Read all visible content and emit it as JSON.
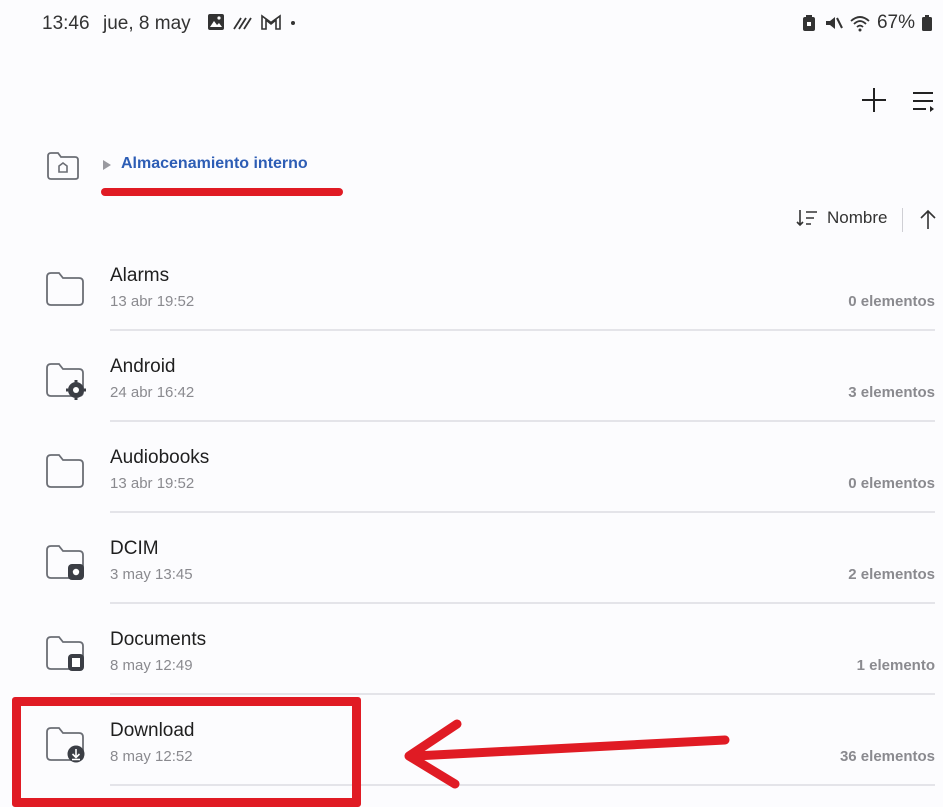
{
  "status_bar": {
    "time": "13:46",
    "date": "jue, 8 may",
    "battery": "67%",
    "notification_icons": [
      "gallery-icon",
      "signal-boost-icon",
      "gmail-icon",
      "dot-icon"
    ],
    "system_icons": [
      "battery-saver-icon",
      "mute-icon",
      "wifi-icon",
      "battery-icon"
    ]
  },
  "toolbar": {
    "actions": [
      "add-icon",
      "sort-menu-icon"
    ]
  },
  "breadcrumb": {
    "current": "Almacenamiento interno"
  },
  "sort": {
    "label": "Nombre",
    "direction": "ascending"
  },
  "files": [
    {
      "name": "Alarms",
      "date": "13 abr 19:52",
      "count": "0 elementos",
      "badge": ""
    },
    {
      "name": "Android",
      "date": "24 abr 16:42",
      "count": "3 elementos",
      "badge": "gear"
    },
    {
      "name": "Audiobooks",
      "date": "13 abr 19:52",
      "count": "0 elementos",
      "badge": ""
    },
    {
      "name": "DCIM",
      "date": "3 may 13:45",
      "count": "2 elementos",
      "badge": "camera"
    },
    {
      "name": "Documents",
      "date": "8 may 12:49",
      "count": "1 elemento",
      "badge": "document"
    },
    {
      "name": "Download",
      "date": "8 may 12:52",
      "count": "36 elementos",
      "badge": "download"
    }
  ],
  "colors": {
    "accent": "#2d5db5",
    "annotation": "#e01b24",
    "folder_stroke": "#6b6e75",
    "secondary_text": "#8a8a8f"
  }
}
